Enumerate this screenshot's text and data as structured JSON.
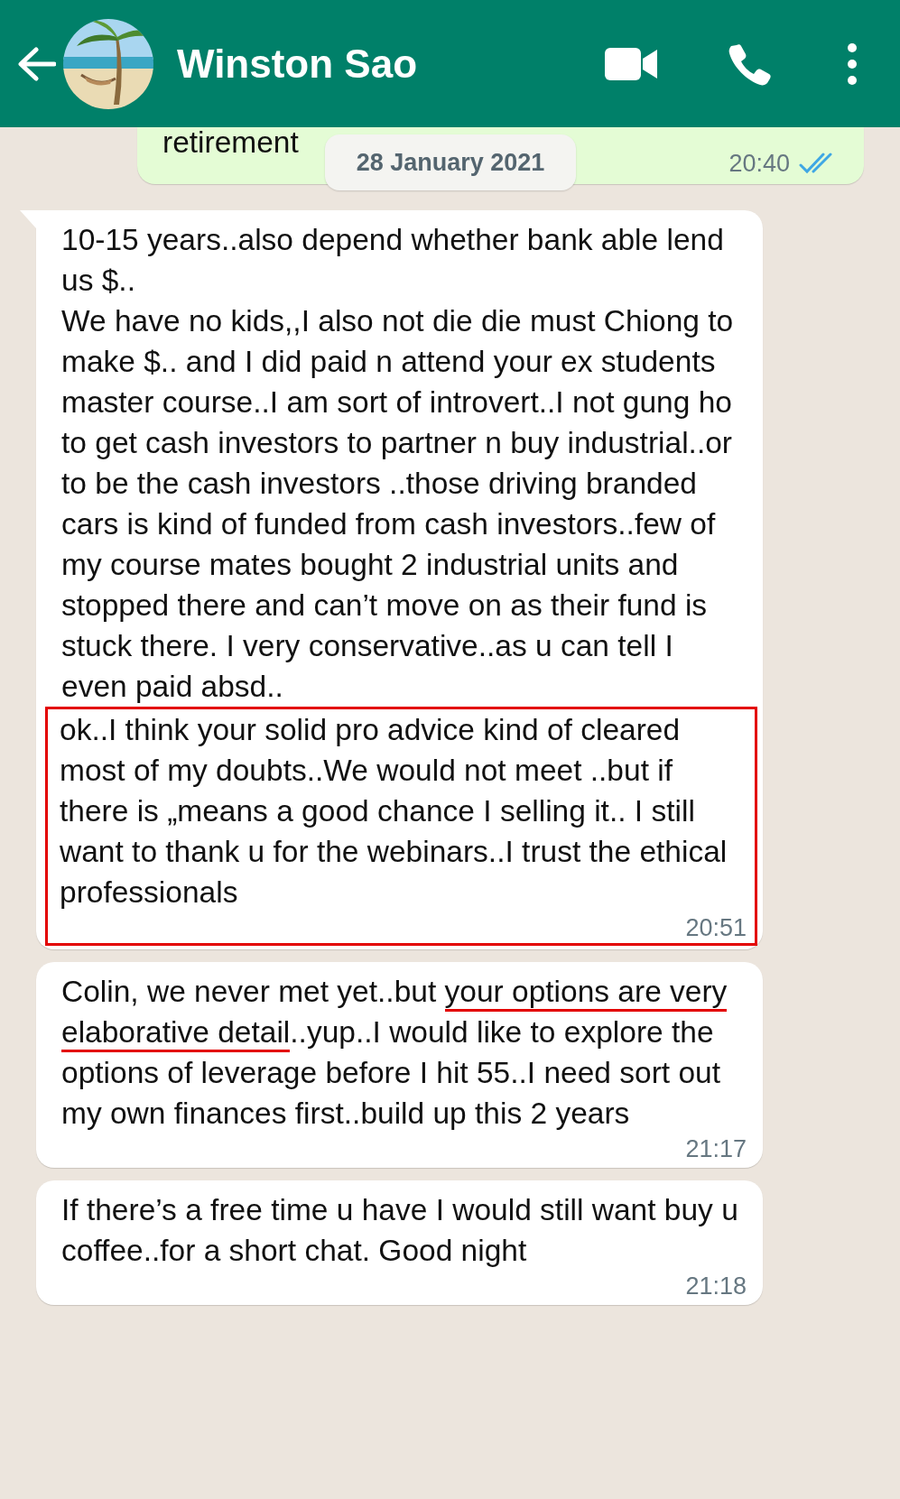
{
  "header": {
    "title": "Winston Sao"
  },
  "date_chip": "28 January 2021",
  "messages": [
    {
      "kind": "sent",
      "paragraphs": [
        {
          "text": "retirement",
          "highlighted": false
        }
      ],
      "time": "20:40",
      "read": true,
      "tail": false
    },
    {
      "kind": "received",
      "tail": true,
      "time": "20:51",
      "paragraphs": [
        {
          "text": "10-15 years..also depend whether bank able lend us $..",
          "highlighted": false
        },
        {
          "text": "We have no kids,,I also not die die must Chiong to make $.. and I did paid n attend your ex students master course..I am sort of introvert..I not gung ho to get cash investors to partner n buy industrial..or to be the cash investors ..those driving branded cars is kind of funded from cash investors..few of my course mates bought 2 industrial units and stopped there and can’t move on as their fund is stuck there. I very conservative..as u can tell I even paid absd..",
          "highlighted": false
        },
        {
          "text": "ok..I think your solid pro advice kind of cleared most of my doubts..We would not meet ..but if there is „means a good chance I selling it.. I still want to thank u for the webinars..I trust the ethical professionals",
          "highlighted": true
        }
      ]
    },
    {
      "kind": "received",
      "tail": false,
      "time": "21:17",
      "paragraphs": [
        {
          "segments": [
            {
              "text": "Colin, we never met yet..but ",
              "underlined": false
            },
            {
              "text": "your options are very elaborative detail",
              "underlined": true
            },
            {
              "text": "..yup..I would like to explore the options of leverage before I hit 55..I need sort out my own finances first..build up this 2 years",
              "underlined": false
            }
          ],
          "highlighted": false
        }
      ]
    },
    {
      "kind": "received",
      "tail": false,
      "time": "21:18",
      "paragraphs": [
        {
          "text": "If there’s a free time u have I would still want buy u coffee..for a short chat. Good night",
          "highlighted": false
        }
      ]
    }
  ]
}
